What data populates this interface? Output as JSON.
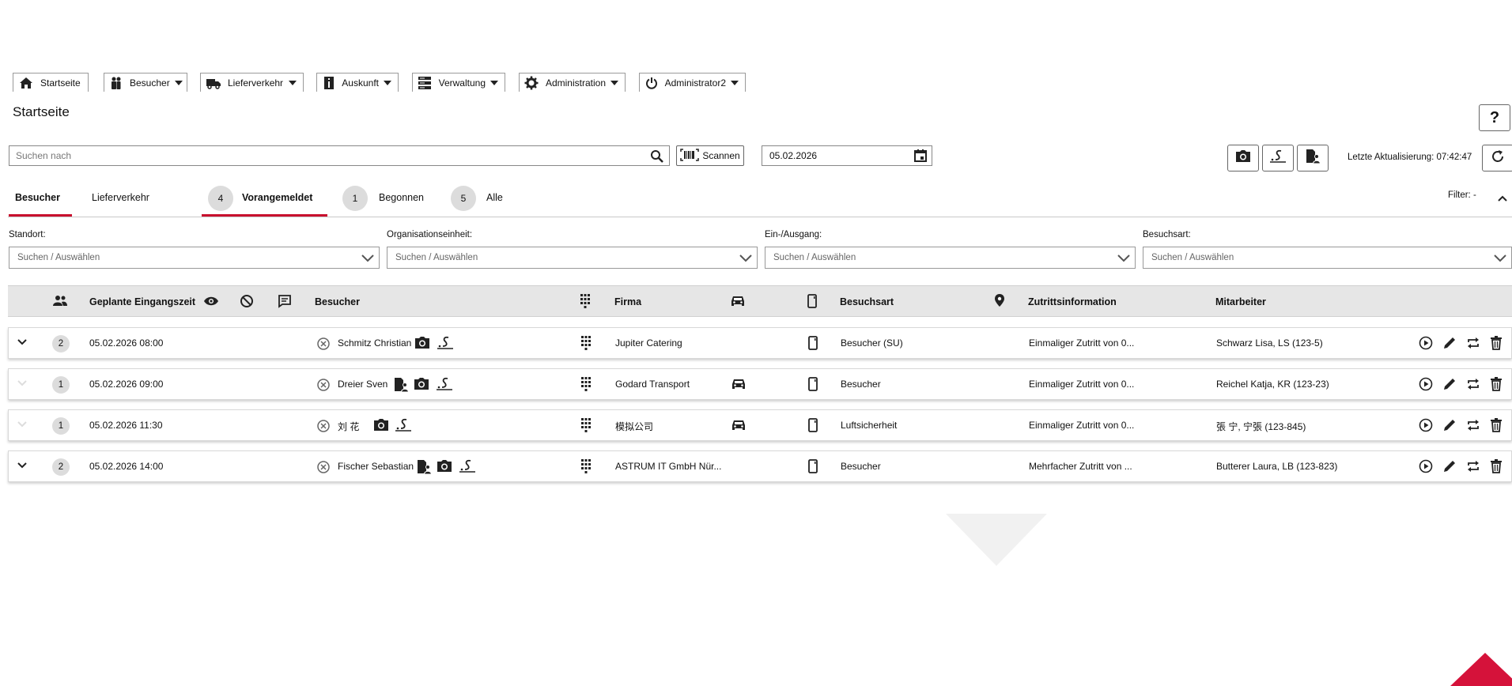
{
  "nav": {
    "items": [
      {
        "label": "Startseite"
      },
      {
        "label": "Besucher"
      },
      {
        "label": "Lieferverkehr"
      },
      {
        "label": "Auskunft"
      },
      {
        "label": "Verwaltung"
      },
      {
        "label": "Administration"
      },
      {
        "label": "Administrator2"
      }
    ]
  },
  "page": {
    "title": "Startseite",
    "help_label": "?"
  },
  "search": {
    "placeholder": "Suchen nach",
    "scan_label": "Scannen",
    "date": "05.02.2026"
  },
  "toolbar": {
    "last_update": "Letzte Aktualisierung: 07:42:47"
  },
  "tabs": {
    "besucher": "Besucher",
    "lieferverkehr": "Lieferverkehr",
    "status": [
      {
        "count": "4",
        "label": "Vorangemeldet"
      },
      {
        "count": "1",
        "label": "Begonnen"
      },
      {
        "count": "5",
        "label": "Alle"
      }
    ],
    "filter_label": "Filter: -"
  },
  "filters": [
    {
      "label": "Standort:",
      "placeholder": "Suchen / Auswählen"
    },
    {
      "label": "Organisationseinheit:",
      "placeholder": "Suchen / Auswählen"
    },
    {
      "label": "Ein-/Ausgang:",
      "placeholder": "Suchen / Auswählen"
    },
    {
      "label": "Besuchsart:",
      "placeholder": "Suchen / Auswählen"
    }
  ],
  "table": {
    "headers": {
      "eingangszeit": "Geplante Eingangszeit",
      "besucher": "Besucher",
      "firma": "Firma",
      "besuchsart": "Besuchsart",
      "zutritt": "Zutrittsinformation",
      "mitarbeiter": "Mitarbeiter"
    },
    "rows": [
      {
        "count": "2",
        "time": "05.02.2026 08:00",
        "visitor": "Schmitz Christian",
        "company": "Jupiter Catering",
        "type": "Besucher (SU)",
        "access": "Einmaliger Zutritt von 0...",
        "employee": "Schwarz Lisa, LS  (123-5)"
      },
      {
        "count": "1",
        "time": "05.02.2026 09:00",
        "visitor": "Dreier Sven",
        "company": "Godard Transport",
        "type": "Besucher",
        "access": "Einmaliger Zutritt von 0...",
        "employee": "Reichel Katja, KR  (123-23)"
      },
      {
        "count": "1",
        "time": "05.02.2026 11:30",
        "visitor": "刘 花",
        "company": "模拟公司",
        "type": "Luftsicherheit",
        "access": "Einmaliger Zutritt von 0...",
        "employee": "張 宁, 宁張  (123-845)"
      },
      {
        "count": "2",
        "time": "05.02.2026 14:00",
        "visitor": "Fischer Sebastian",
        "company": "ASTRUM IT GmbH Nür...",
        "type": "Besucher",
        "access": "Mehrfacher Zutritt von ...",
        "employee": "Butterer Laura, LB  (123-823)"
      }
    ]
  },
  "colors": {
    "accent": "#c8102e",
    "header_bg": "#e6e6e6",
    "badge_bg": "#dcdcdc"
  }
}
